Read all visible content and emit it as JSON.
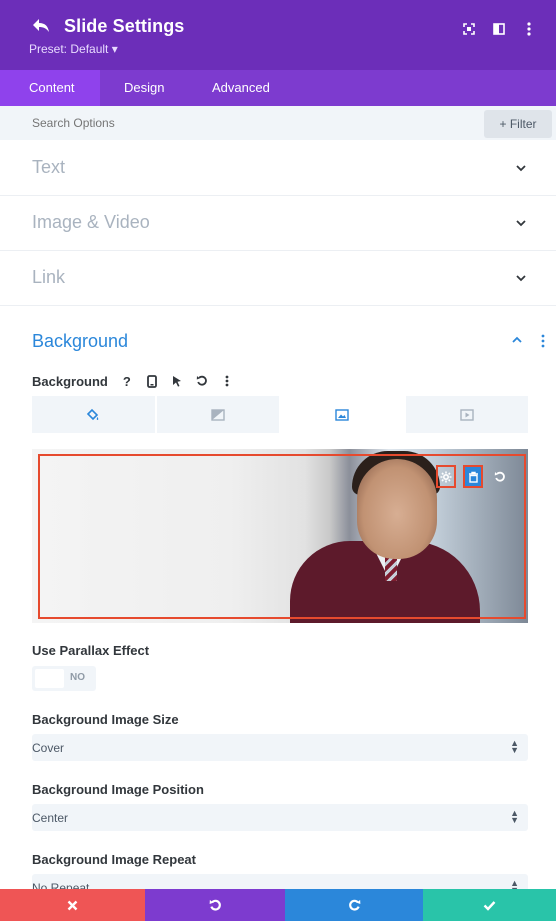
{
  "header": {
    "title": "Slide Settings",
    "preset_label": "Preset: Default ▾",
    "icons": [
      "back-icon",
      "fullscreen-icon",
      "split-view-icon",
      "more-icon"
    ]
  },
  "tabs": [
    {
      "label": "Content",
      "active": true
    },
    {
      "label": "Design",
      "active": false
    },
    {
      "label": "Advanced",
      "active": false
    }
  ],
  "search": {
    "placeholder": "Search Options",
    "filter_label": "+ Filter"
  },
  "sections": [
    {
      "label": "Text"
    },
    {
      "label": "Image & Video"
    },
    {
      "label": "Link"
    }
  ],
  "background_section": {
    "title": "Background",
    "field_label": "Background",
    "help_glyph": "?",
    "type_tabs": [
      "color-fill-icon",
      "gradient-icon",
      "image-icon",
      "video-icon"
    ],
    "active_type": "image-icon",
    "preview_actions": [
      "settings-icon",
      "trash-icon",
      "reset-icon"
    ]
  },
  "fields": {
    "parallax_label": "Use Parallax Effect",
    "parallax_value": "NO",
    "size_label": "Background Image Size",
    "size_value": "Cover",
    "position_label": "Background Image Position",
    "position_value": "Center",
    "repeat_label": "Background Image Repeat",
    "repeat_value": "No Repeat"
  },
  "footer": [
    "cancel-icon",
    "undo-icon",
    "redo-icon",
    "save-icon"
  ],
  "colors": {
    "header": "#6c2eb9",
    "tabs": "#7d3bcf",
    "active_tab": "#8f42ec",
    "accent_blue": "#2b87da",
    "cancel": "#ef5555",
    "save": "#29c4a9",
    "highlight": "#e64a2e"
  }
}
